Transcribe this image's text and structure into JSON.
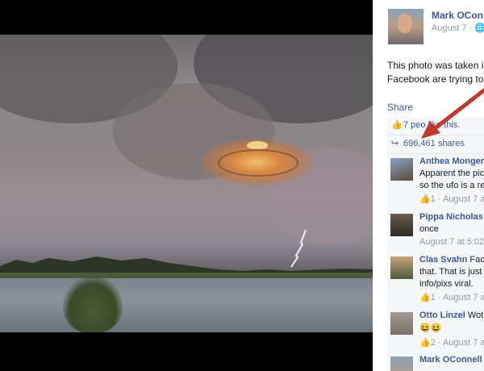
{
  "author": {
    "name": "Mark OConn",
    "date": "August 7 · 🌐"
  },
  "post": {
    "text_line1": "This photo was taken i",
    "text_line2": "Facebook are trying to",
    "share_label": "Share"
  },
  "ufi": {
    "likes_text": "7 peo   like this.",
    "shares_text": "696,461 shares"
  },
  "comments": [
    {
      "name": "Anthea Monger",
      "lines": [
        "Apparent the pic",
        "so the ufo is a re"
      ],
      "meta": "👍1 · August 7 a"
    },
    {
      "name": "Pippa Nicholas",
      "lines": [
        "once"
      ],
      "meta": "August 7 at 5:02"
    },
    {
      "name": "Clas Svahn",
      "lines": [
        "that. That is just",
        "info/pixs viral."
      ],
      "name_suffix": " Fac",
      "meta": "👍1 · August 7 a"
    },
    {
      "name": "Otto Linzel",
      "name_suffix": " Wot",
      "lines": [
        "😆😆"
      ],
      "meta": "👍2 · August 7 a"
    },
    {
      "name": "Mark OConnell",
      "lines": [],
      "meta": ""
    }
  ],
  "colors": {
    "link": "#3b5998",
    "arrow": "#c0392b"
  }
}
